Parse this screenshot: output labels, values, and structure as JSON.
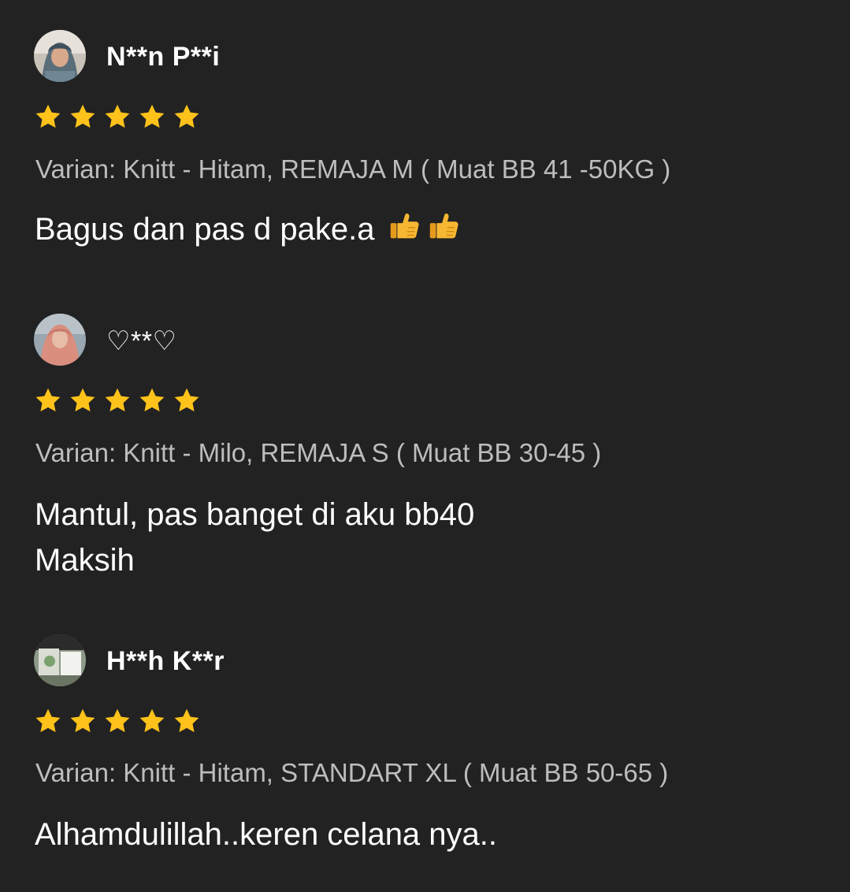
{
  "theme": {
    "background": "#222222",
    "text": "#ffffff",
    "muted_text": "#bdbdbd",
    "star_color": "#ffc21a"
  },
  "reviews": [
    {
      "username": "N**n P**i",
      "rating": 5,
      "avatar": "user-photo",
      "variant": "Varian: Knitt - Hitam, REMAJA M ( Muat BB 41 -50KG )",
      "comment": "Bagus dan pas d pake.a",
      "emoji": [
        "thumbs-up-icon",
        "thumbs-up-icon"
      ]
    },
    {
      "username": "♡**♡",
      "rating": 5,
      "avatar": "user-photo",
      "variant": "Varian: Knitt - Milo, REMAJA S ( Muat BB 30-45 )",
      "comment": "Mantul, pas banget di aku bb40\nMaksih",
      "emoji": []
    },
    {
      "username": "H**h K**r",
      "rating": 5,
      "avatar": "user-photo",
      "variant": "Varian: Knitt - Hitam, STANDART XL ( Muat BB 50-65 )",
      "comment": "Alhamdulillah..keren celana nya..",
      "emoji": []
    }
  ]
}
